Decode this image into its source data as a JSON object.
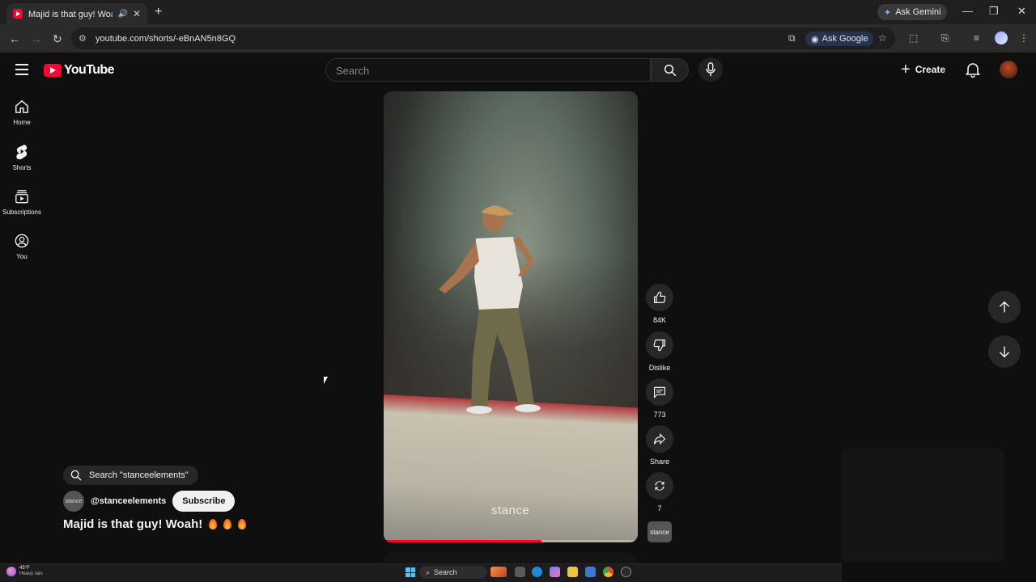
{
  "browser": {
    "tab_title": "Majid is that guy! Woah! 🔥",
    "tab_close": "✕",
    "new_tab": "+",
    "ask_gemini": "Ask Gemini",
    "url": "youtube.com/shorts/-eBnAN5n8GQ",
    "ask_google": "Ask Google",
    "window_controls": [
      "—",
      "❐",
      "✕"
    ]
  },
  "youtube": {
    "logo_text": "YouTube",
    "search_placeholder": "Search",
    "create_label": "Create",
    "guide": [
      {
        "label": "Home",
        "icon": "home-icon"
      },
      {
        "label": "Shorts",
        "icon": "shorts-icon"
      },
      {
        "label": "Subscriptions",
        "icon": "subscriptions-icon"
      },
      {
        "label": "You",
        "icon": "you-icon"
      }
    ]
  },
  "short": {
    "watermark": "stance",
    "progress": 0.62,
    "actions": {
      "like_count": "84K",
      "dislike_label": "Dislike",
      "comment_count": "773",
      "share_label": "Share",
      "remix_count": "7"
    },
    "channel_thumb_text": "stance",
    "search_chip": "Search \"stanceelements\"",
    "channel_avatar_text": "stance",
    "channel_handle": "@stanceelements",
    "subscribe_label": "Subscribe",
    "caption": "Majid is that guy! Woah!"
  },
  "taskbar": {
    "temperature": "45°F",
    "weather": "Heavy rain",
    "search_label": "Search"
  },
  "colors": {
    "background": "#0f0f0f",
    "youtube_red": "#ff0033",
    "chip": "#272727"
  }
}
